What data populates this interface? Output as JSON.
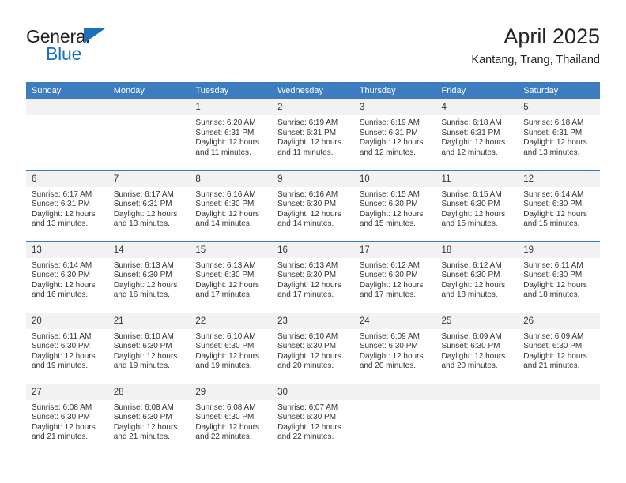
{
  "brand": {
    "line1": "General",
    "line2": "Blue",
    "triangle_color": "#1a72ba"
  },
  "header": {
    "title": "April 2025",
    "subtitle": "Kantang, Trang, Thailand"
  },
  "colors": {
    "header_blue": "#3d7dbf",
    "daynum_bg": "#f2f2f2",
    "text": "#333333"
  },
  "calendar": {
    "weekday_headers": [
      "Sunday",
      "Monday",
      "Tuesday",
      "Wednesday",
      "Thursday",
      "Friday",
      "Saturday"
    ],
    "weeks": [
      [
        {
          "day": "",
          "empty": true,
          "lines": []
        },
        {
          "day": "",
          "empty": true,
          "lines": []
        },
        {
          "day": "1",
          "lines": [
            "Sunrise: 6:20 AM",
            "Sunset: 6:31 PM",
            "Daylight: 12 hours and 11 minutes."
          ]
        },
        {
          "day": "2",
          "lines": [
            "Sunrise: 6:19 AM",
            "Sunset: 6:31 PM",
            "Daylight: 12 hours and 11 minutes."
          ]
        },
        {
          "day": "3",
          "lines": [
            "Sunrise: 6:19 AM",
            "Sunset: 6:31 PM",
            "Daylight: 12 hours and 12 minutes."
          ]
        },
        {
          "day": "4",
          "lines": [
            "Sunrise: 6:18 AM",
            "Sunset: 6:31 PM",
            "Daylight: 12 hours and 12 minutes."
          ]
        },
        {
          "day": "5",
          "lines": [
            "Sunrise: 6:18 AM",
            "Sunset: 6:31 PM",
            "Daylight: 12 hours and 13 minutes."
          ]
        }
      ],
      [
        {
          "day": "6",
          "lines": [
            "Sunrise: 6:17 AM",
            "Sunset: 6:31 PM",
            "Daylight: 12 hours and 13 minutes."
          ]
        },
        {
          "day": "7",
          "lines": [
            "Sunrise: 6:17 AM",
            "Sunset: 6:31 PM",
            "Daylight: 12 hours and 13 minutes."
          ]
        },
        {
          "day": "8",
          "lines": [
            "Sunrise: 6:16 AM",
            "Sunset: 6:30 PM",
            "Daylight: 12 hours and 14 minutes."
          ]
        },
        {
          "day": "9",
          "lines": [
            "Sunrise: 6:16 AM",
            "Sunset: 6:30 PM",
            "Daylight: 12 hours and 14 minutes."
          ]
        },
        {
          "day": "10",
          "lines": [
            "Sunrise: 6:15 AM",
            "Sunset: 6:30 PM",
            "Daylight: 12 hours and 15 minutes."
          ]
        },
        {
          "day": "11",
          "lines": [
            "Sunrise: 6:15 AM",
            "Sunset: 6:30 PM",
            "Daylight: 12 hours and 15 minutes."
          ]
        },
        {
          "day": "12",
          "lines": [
            "Sunrise: 6:14 AM",
            "Sunset: 6:30 PM",
            "Daylight: 12 hours and 15 minutes."
          ]
        }
      ],
      [
        {
          "day": "13",
          "lines": [
            "Sunrise: 6:14 AM",
            "Sunset: 6:30 PM",
            "Daylight: 12 hours and 16 minutes."
          ]
        },
        {
          "day": "14",
          "lines": [
            "Sunrise: 6:13 AM",
            "Sunset: 6:30 PM",
            "Daylight: 12 hours and 16 minutes."
          ]
        },
        {
          "day": "15",
          "lines": [
            "Sunrise: 6:13 AM",
            "Sunset: 6:30 PM",
            "Daylight: 12 hours and 17 minutes."
          ]
        },
        {
          "day": "16",
          "lines": [
            "Sunrise: 6:13 AM",
            "Sunset: 6:30 PM",
            "Daylight: 12 hours and 17 minutes."
          ]
        },
        {
          "day": "17",
          "lines": [
            "Sunrise: 6:12 AM",
            "Sunset: 6:30 PM",
            "Daylight: 12 hours and 17 minutes."
          ]
        },
        {
          "day": "18",
          "lines": [
            "Sunrise: 6:12 AM",
            "Sunset: 6:30 PM",
            "Daylight: 12 hours and 18 minutes."
          ]
        },
        {
          "day": "19",
          "lines": [
            "Sunrise: 6:11 AM",
            "Sunset: 6:30 PM",
            "Daylight: 12 hours and 18 minutes."
          ]
        }
      ],
      [
        {
          "day": "20",
          "lines": [
            "Sunrise: 6:11 AM",
            "Sunset: 6:30 PM",
            "Daylight: 12 hours and 19 minutes."
          ]
        },
        {
          "day": "21",
          "lines": [
            "Sunrise: 6:10 AM",
            "Sunset: 6:30 PM",
            "Daylight: 12 hours and 19 minutes."
          ]
        },
        {
          "day": "22",
          "lines": [
            "Sunrise: 6:10 AM",
            "Sunset: 6:30 PM",
            "Daylight: 12 hours and 19 minutes."
          ]
        },
        {
          "day": "23",
          "lines": [
            "Sunrise: 6:10 AM",
            "Sunset: 6:30 PM",
            "Daylight: 12 hours and 20 minutes."
          ]
        },
        {
          "day": "24",
          "lines": [
            "Sunrise: 6:09 AM",
            "Sunset: 6:30 PM",
            "Daylight: 12 hours and 20 minutes."
          ]
        },
        {
          "day": "25",
          "lines": [
            "Sunrise: 6:09 AM",
            "Sunset: 6:30 PM",
            "Daylight: 12 hours and 20 minutes."
          ]
        },
        {
          "day": "26",
          "lines": [
            "Sunrise: 6:09 AM",
            "Sunset: 6:30 PM",
            "Daylight: 12 hours and 21 minutes."
          ]
        }
      ],
      [
        {
          "day": "27",
          "lines": [
            "Sunrise: 6:08 AM",
            "Sunset: 6:30 PM",
            "Daylight: 12 hours and 21 minutes."
          ]
        },
        {
          "day": "28",
          "lines": [
            "Sunrise: 6:08 AM",
            "Sunset: 6:30 PM",
            "Daylight: 12 hours and 21 minutes."
          ]
        },
        {
          "day": "29",
          "lines": [
            "Sunrise: 6:08 AM",
            "Sunset: 6:30 PM",
            "Daylight: 12 hours and 22 minutes."
          ]
        },
        {
          "day": "30",
          "lines": [
            "Sunrise: 6:07 AM",
            "Sunset: 6:30 PM",
            "Daylight: 12 hours and 22 minutes."
          ]
        },
        {
          "day": "",
          "empty": true,
          "lines": []
        },
        {
          "day": "",
          "empty": true,
          "lines": []
        },
        {
          "day": "",
          "empty": true,
          "lines": []
        }
      ]
    ]
  }
}
